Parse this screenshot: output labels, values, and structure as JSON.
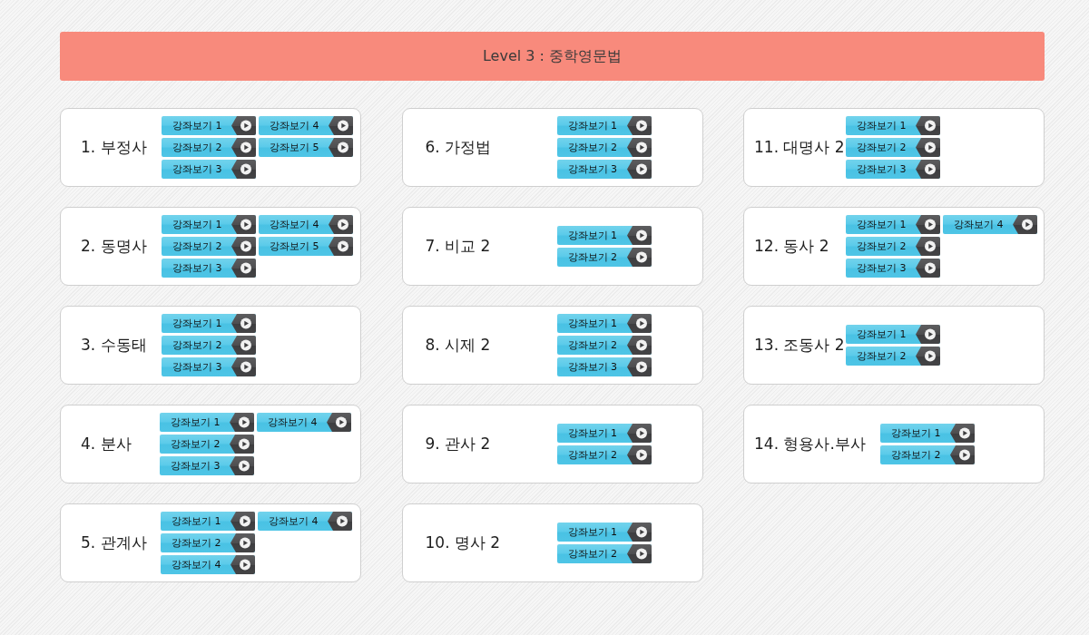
{
  "header": {
    "title": "Level 3 : 중학영문법"
  },
  "columns": [
    {
      "topics": [
        {
          "title": "1. 부정사",
          "lectures": [
            "강좌보기 1",
            "강좌보기 2",
            "강좌보기 3",
            "강좌보기 4",
            "강좌보기 5"
          ]
        },
        {
          "title": "2. 동명사",
          "lectures": [
            "강좌보기 1",
            "강좌보기 2",
            "강좌보기 3",
            "강좌보기 4",
            "강좌보기 5"
          ]
        },
        {
          "title": "3. 수동태",
          "lectures": [
            "강좌보기 1",
            "강좌보기 2",
            "강좌보기 3"
          ]
        },
        {
          "title": "4. 분사",
          "lectures": [
            "강좌보기 1",
            "강좌보기 2",
            "강좌보기 3",
            "강좌보기 4"
          ]
        },
        {
          "title": "5. 관계사",
          "lectures": [
            "강좌보기 1",
            "강좌보기 2",
            "강좌보기 4",
            "강좌보기 4"
          ]
        }
      ]
    },
    {
      "topics": [
        {
          "title": "6. 가정법",
          "lectures": [
            "강좌보기 1",
            "강좌보기 2",
            "강좌보기 3"
          ]
        },
        {
          "title": "7. 비교 2",
          "lectures": [
            "강좌보기 1",
            "강좌보기 2"
          ]
        },
        {
          "title": "8. 시제 2",
          "lectures": [
            "강좌보기 1",
            "강좌보기 2",
            "강좌보기 3"
          ]
        },
        {
          "title": "9. 관사 2",
          "lectures": [
            "강좌보기 1",
            "강좌보기 2"
          ]
        },
        {
          "title": "10. 명사 2",
          "lectures": [
            "강좌보기 1",
            "강좌보기 2"
          ]
        }
      ]
    },
    {
      "topics": [
        {
          "title": "11. 대명사 2",
          "lectures": [
            "강좌보기 1",
            "강좌보기 2",
            "강좌보기 3"
          ]
        },
        {
          "title": "12. 동사 2",
          "lectures": [
            "강좌보기 1",
            "강좌보기 2",
            "강좌보기 3",
            "강좌보기 4"
          ]
        },
        {
          "title": "13. 조동사 2",
          "lectures": [
            "강좌보기 1",
            "강좌보기 2"
          ]
        },
        {
          "title": "14. 형용사.부사",
          "lectures": [
            "강좌보기 1",
            "강좌보기 2"
          ]
        }
      ]
    }
  ]
}
